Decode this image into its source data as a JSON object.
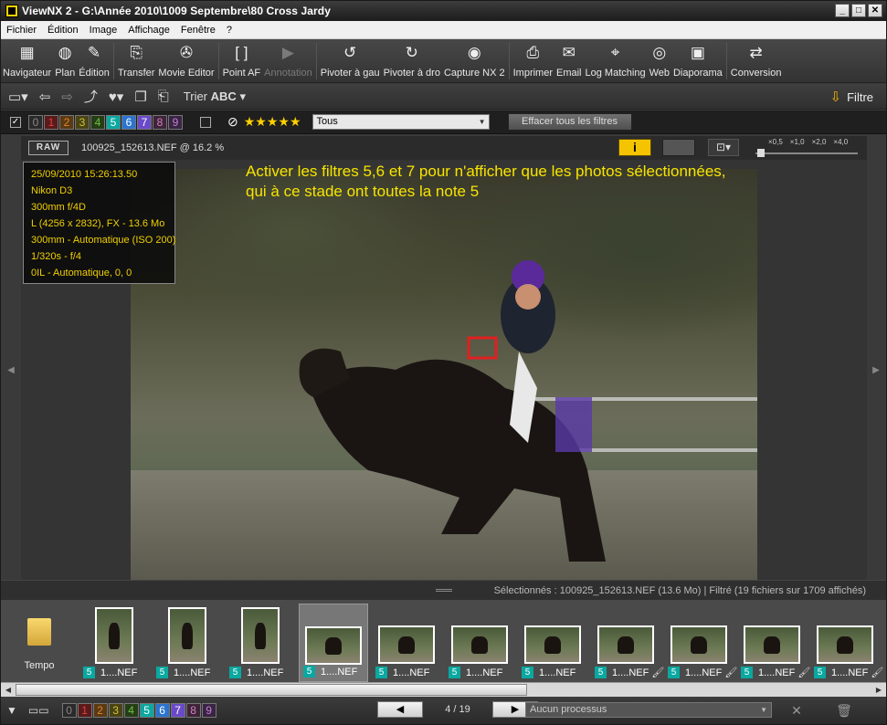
{
  "window": {
    "title": "ViewNX 2 - G:\\Année 2010\\1009 Septembre\\80 Cross Jardy",
    "controls": [
      "_",
      "□",
      "✕"
    ]
  },
  "menu": [
    "Fichier",
    "Édition",
    "Image",
    "Affichage",
    "Fenêtre",
    "?"
  ],
  "toolbar": [
    {
      "name": "navigateur",
      "label": "Navigateur",
      "icon": "▦",
      "enabled": true
    },
    {
      "name": "plan",
      "label": "Plan",
      "icon": "◍",
      "enabled": true
    },
    {
      "name": "edition",
      "label": "Édition",
      "icon": "✎",
      "enabled": true
    },
    {
      "name": "transfer",
      "label": "Transfer",
      "icon": "⎘",
      "enabled": true
    },
    {
      "name": "movie-editor",
      "label": "Movie Editor",
      "icon": "✇",
      "enabled": true
    },
    {
      "name": "point-af",
      "label": "Point AF",
      "icon": "[ ]",
      "enabled": true
    },
    {
      "name": "annotation",
      "label": "Annotation",
      "icon": "▶",
      "enabled": false
    },
    {
      "name": "pivoter-gauche",
      "label": "Pivoter à gau",
      "icon": "↺",
      "enabled": true
    },
    {
      "name": "pivoter-droite",
      "label": "Pivoter à dro",
      "icon": "↻",
      "enabled": true
    },
    {
      "name": "capture-nx2",
      "label": "Capture NX 2",
      "icon": "◉",
      "enabled": true
    },
    {
      "name": "imprimer",
      "label": "Imprimer",
      "icon": "⎙",
      "enabled": true
    },
    {
      "name": "email",
      "label": "Email",
      "icon": "✉",
      "enabled": true
    },
    {
      "name": "log-matching",
      "label": "Log Matching",
      "icon": "⌖",
      "enabled": true
    },
    {
      "name": "web",
      "label": "Web",
      "icon": "◎",
      "enabled": true
    },
    {
      "name": "diaporama",
      "label": "Diaporama",
      "icon": "▣",
      "enabled": true
    },
    {
      "name": "conversion",
      "label": "Conversion",
      "icon": "⇄",
      "enabled": true
    }
  ],
  "toolbar2": {
    "trier_label": "Trier",
    "trier_mode": "ABC",
    "filtre_label": "Filtre"
  },
  "filters": {
    "labels": [
      {
        "n": "0",
        "color": "#888888",
        "bg": "#2a2a2a"
      },
      {
        "n": "1",
        "color": "#e04040",
        "bg": "#5a1a1a"
      },
      {
        "n": "2",
        "color": "#e08030",
        "bg": "#5a3a12"
      },
      {
        "n": "3",
        "color": "#d0c040",
        "bg": "#4a4414"
      },
      {
        "n": "4",
        "color": "#70c040",
        "bg": "#253e16"
      },
      {
        "n": "5",
        "color": "#ffffff",
        "bg": "#0aa8a0"
      },
      {
        "n": "6",
        "color": "#ffffff",
        "bg": "#2a74d0"
      },
      {
        "n": "7",
        "color": "#ffffff",
        "bg": "#6a4ac8"
      },
      {
        "n": "8",
        "color": "#d080c0",
        "bg": "#3e2438"
      },
      {
        "n": "9",
        "color": "#c080d0",
        "bg": "#3a2444"
      }
    ],
    "stars": "★★★★★",
    "select_value": "Tous",
    "clear_button": "Effacer tous les filtres"
  },
  "viewer": {
    "raw_badge": "RAW",
    "file_label": "100925_152613.NEF @ 16.2 %",
    "info_button": "i",
    "zoom_levels": [
      "×0,5",
      "×1,0",
      "×2,0",
      "×4,0"
    ]
  },
  "exif": [
    "25/09/2010 15:26:13.50",
    "Nikon D3",
    "300mm f/4D",
    "L (4256 x 2832), FX - 13.6 Mo",
    "300mm - Automatique (ISO 200)",
    "1/320s - f/4",
    "0IL - Automatique, 0, 0"
  ],
  "annotation": {
    "line1": "Activer les filtres 5,6 et 7 pour n'afficher que les photos sélectionnées,",
    "line2": "qui à ce stade ont toutes la note 5"
  },
  "status": "Sélectionnés : 100925_152613.NEF (13.6 Mo) | Filtré  (19 fichiers sur 1709 affichés)",
  "filmstrip": {
    "folder_label": "Tempo",
    "thumbs": [
      {
        "label": "1....NEF",
        "badge": "5",
        "orient": "port",
        "brush": false,
        "selected": false
      },
      {
        "label": "1....NEF",
        "badge": "5",
        "orient": "port",
        "brush": false,
        "selected": false
      },
      {
        "label": "1....NEF",
        "badge": "5",
        "orient": "port",
        "brush": false,
        "selected": false
      },
      {
        "label": "1....NEF",
        "badge": "5",
        "orient": "land",
        "brush": false,
        "selected": true
      },
      {
        "label": "1....NEF",
        "badge": "5",
        "orient": "land",
        "brush": false,
        "selected": false
      },
      {
        "label": "1....NEF",
        "badge": "5",
        "orient": "land",
        "brush": false,
        "selected": false
      },
      {
        "label": "1....NEF",
        "badge": "5",
        "orient": "land",
        "brush": false,
        "selected": false
      },
      {
        "label": "1....NEF",
        "badge": "5",
        "orient": "land",
        "brush": true,
        "selected": false
      },
      {
        "label": "1....NEF",
        "badge": "5",
        "orient": "land",
        "brush": true,
        "selected": false
      },
      {
        "label": "1....NEF",
        "badge": "5",
        "orient": "land",
        "brush": true,
        "selected": false
      },
      {
        "label": "1....NEF",
        "badge": "5",
        "orient": "land",
        "brush": true,
        "selected": false
      }
    ]
  },
  "bottom": {
    "prev": "◀",
    "next": "▶",
    "pager": "4 / 19",
    "process": "Aucun processus"
  }
}
